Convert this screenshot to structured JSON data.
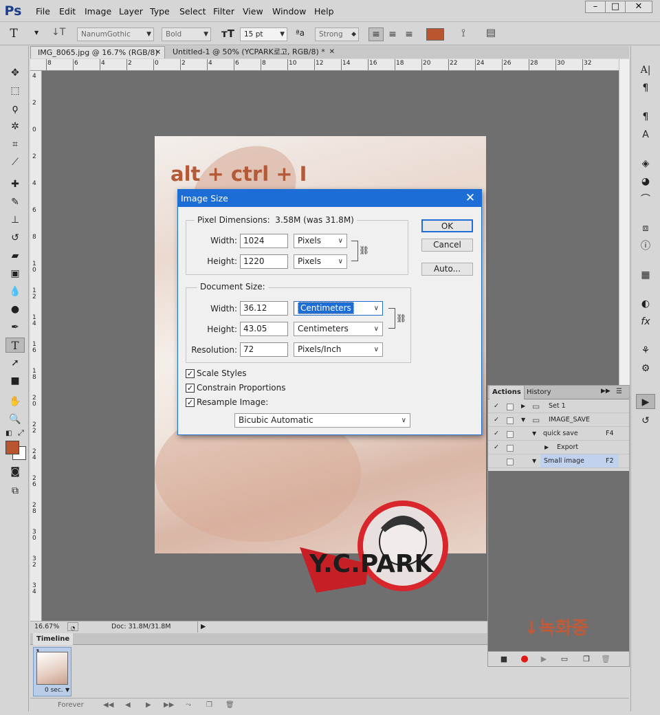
{
  "app": {
    "logo": "Ps",
    "menu": [
      "File",
      "Edit",
      "Image",
      "Layer",
      "Type",
      "Select",
      "Filter",
      "View",
      "Window",
      "Help"
    ],
    "window_buttons": [
      "–",
      "□",
      "✕"
    ]
  },
  "options": {
    "tool_glyph": "T",
    "font_family": "NanumGothic",
    "font_style": "Bold",
    "font_size": "15 pt",
    "antialias": "Strong",
    "color": "#b9562f"
  },
  "tabs": [
    {
      "label": "IMG_8065.jpg @ 16.7% (RGB/8)",
      "close": "✕"
    },
    {
      "label": "Untitled-1 @ 50% (YCPARK로고, RGB/8) *",
      "close": "✕"
    }
  ],
  "ruler": {
    "top": [
      "8",
      "6",
      "4",
      "2",
      "0",
      "2",
      "4",
      "6",
      "8",
      "10",
      "12",
      "14",
      "16",
      "18",
      "20",
      "22",
      "24",
      "26",
      "28",
      "30",
      "32"
    ],
    "left": [
      "4",
      "2",
      "0",
      "2",
      "4",
      "6",
      "8",
      "1 0",
      "1 2",
      "1 4",
      "1 6",
      "1 8",
      "2 0",
      "2 2",
      "2 4",
      "2 6",
      "2 8",
      "3 0",
      "3 2",
      "3 4"
    ]
  },
  "canvas": {
    "hint": "alt + ctrl + I"
  },
  "status": {
    "zoom": "16.67%",
    "doc": "Doc: 31.8M/31.8M"
  },
  "timeline": {
    "title": "Timeline",
    "frame_number": "1",
    "frame_delay": "0 sec.",
    "loop": "Forever"
  },
  "dialog": {
    "title": "Image Size",
    "close": "✕",
    "pixel_dimensions": {
      "label": "Pixel Dimensions:",
      "value": "3.58M (was 31.8M)",
      "width_label": "Width:",
      "width": "1024",
      "width_unit": "Pixels",
      "height_label": "Height:",
      "height": "1220",
      "height_unit": "Pixels"
    },
    "document_size": {
      "label": "Document Size:",
      "width_label": "Width:",
      "width": "36.12",
      "width_unit": "Centimeters",
      "height_label": "Height:",
      "height": "43.05",
      "height_unit": "Centimeters",
      "resolution_label": "Resolution:",
      "resolution": "72",
      "resolution_unit": "Pixels/Inch"
    },
    "checks": [
      {
        "label": "Scale Styles",
        "checked": true
      },
      {
        "label": "Constrain Proportions",
        "checked": true
      },
      {
        "label": "Resample Image:",
        "checked": true
      }
    ],
    "resample_method": "Bicubic Automatic",
    "buttons": {
      "ok": "OK",
      "cancel": "Cancel",
      "auto": "Auto..."
    }
  },
  "actions_panel": {
    "tabs": [
      "Actions",
      "History"
    ],
    "rows": [
      {
        "name": "Set 1",
        "key": "",
        "check": "✓",
        "type": "set"
      },
      {
        "name": "IMAGE_SAVE",
        "key": "",
        "check": "✓",
        "type": "set"
      },
      {
        "name": "quick save",
        "key": "F4",
        "check": "✓",
        "type": "action"
      },
      {
        "name": "Export",
        "key": "",
        "check": "✓",
        "type": "step"
      },
      {
        "name": "Small image",
        "key": "F2",
        "check": "",
        "type": "action"
      }
    ]
  },
  "watermark": {
    "text": "Y.C.PARK"
  },
  "annotation": {
    "recording": "↓녹화중"
  }
}
